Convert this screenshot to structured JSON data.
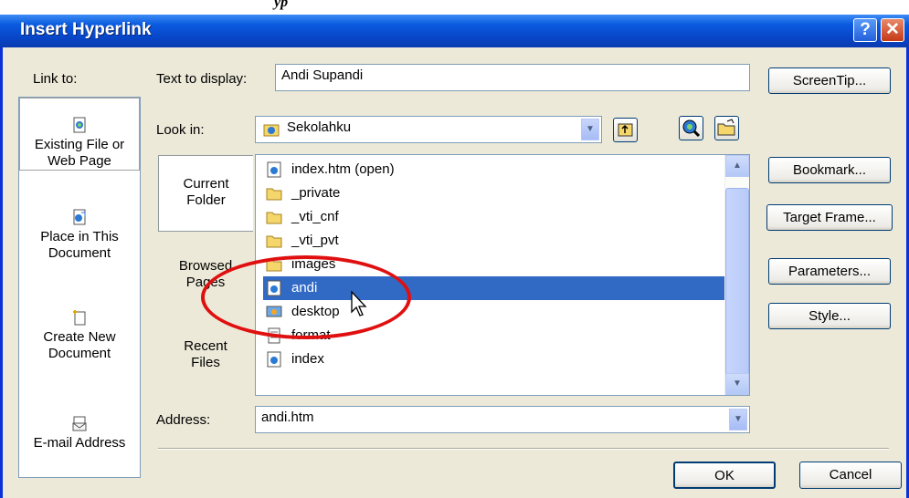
{
  "window": {
    "title": "Insert Hyperlink"
  },
  "titlebar": {
    "help_label": "?",
    "close_label": "✕"
  },
  "caption_fragment": "yp",
  "link_to": {
    "label": "Link to:",
    "items": [
      {
        "label_line1": "Existing File or",
        "label_line2": "Web Page",
        "icon": "existing-file-icon",
        "selected": true
      },
      {
        "label_line1": "Place in This",
        "label_line2": "Document",
        "icon": "place-in-document-icon",
        "selected": false
      },
      {
        "label_line1": "Create New",
        "label_line2": "Document",
        "icon": "create-new-document-icon",
        "selected": false
      },
      {
        "label_line1": "E-mail Address",
        "label_line2": "",
        "icon": "email-address-icon",
        "selected": false
      }
    ]
  },
  "text_to_display": {
    "label": "Text to display:",
    "value": "Andi Supandi"
  },
  "screentip_button": "ScreenTip...",
  "look_in": {
    "label": "Look in:",
    "value": "Sekolahku"
  },
  "side_tabs": [
    {
      "line1": "Current",
      "line2": "Folder",
      "selected": true
    },
    {
      "line1": "Browsed",
      "line2": "Pages",
      "selected": false
    },
    {
      "line1": "Recent",
      "line2": "Files",
      "selected": false
    }
  ],
  "files": [
    {
      "name": "index.htm (open)",
      "icon": "web-page-icon",
      "selected": false
    },
    {
      "name": "_private",
      "icon": "folder-icon",
      "selected": false
    },
    {
      "name": "_vti_cnf",
      "icon": "folder-icon",
      "selected": false
    },
    {
      "name": "_vti_pvt",
      "icon": "folder-icon",
      "selected": false
    },
    {
      "name": "images",
      "icon": "folder-icon",
      "selected": false
    },
    {
      "name": "andi",
      "icon": "web-page-icon",
      "selected": true
    },
    {
      "name": "desktop",
      "icon": "desktop-icon",
      "selected": false
    },
    {
      "name": "format",
      "icon": "text-file-icon",
      "selected": false
    },
    {
      "name": "index",
      "icon": "web-page-icon",
      "selected": false
    }
  ],
  "right_buttons": {
    "bookmark": "Bookmark...",
    "target_frame": "Target Frame...",
    "parameters": "Parameters...",
    "style": "Style..."
  },
  "address": {
    "label": "Address:",
    "value": "andi.htm"
  },
  "ok_button": "OK",
  "cancel_button": "Cancel",
  "colors": {
    "title_bar": "#0a5ae0",
    "selection": "#316ac5",
    "annotation_ellipse": "#e01010",
    "dialog_bg": "#ece9d8"
  }
}
